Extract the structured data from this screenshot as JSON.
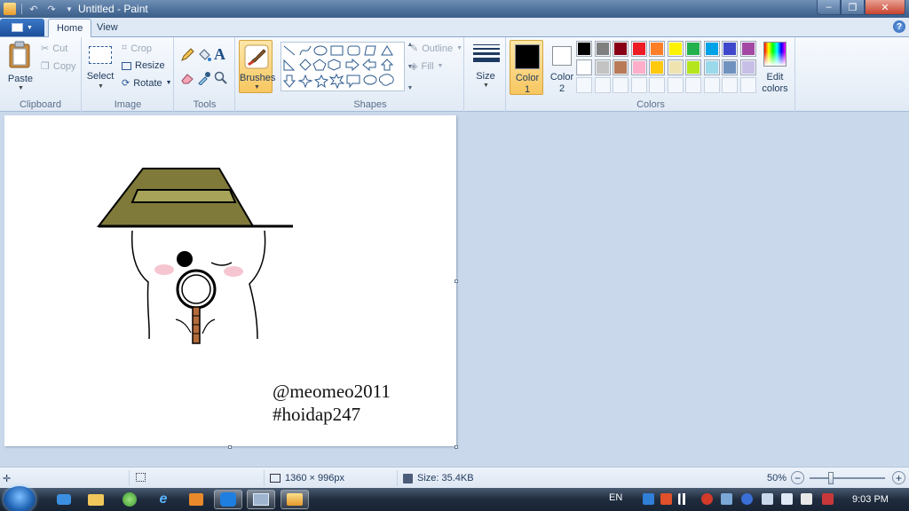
{
  "window": {
    "title": "Untitled - Paint",
    "controls": {
      "minimize": "–",
      "maximize": "❐",
      "close": "✕"
    }
  },
  "tabs": [
    {
      "label": "Home",
      "active": true
    },
    {
      "label": "View",
      "active": false
    }
  ],
  "ribbon": {
    "clipboard": {
      "group_label": "Clipboard",
      "paste": "Paste",
      "cut": "Cut",
      "copy": "Copy"
    },
    "image": {
      "group_label": "Image",
      "select": "Select",
      "crop": "Crop",
      "resize": "Resize",
      "rotate": "Rotate"
    },
    "tools": {
      "group_label": "Tools",
      "text_tool_glyph": "A"
    },
    "brushes": {
      "label": "Brushes"
    },
    "shapes": {
      "group_label": "Shapes",
      "outline": "Outline",
      "fill": "Fill"
    },
    "size": {
      "label": "Size"
    },
    "colors": {
      "group_label": "Colors",
      "color1": "Color 1",
      "color1_line1": "Color",
      "color1_line2": "1",
      "color2_line1": "Color",
      "color2_line2": "2",
      "edit_line1": "Edit",
      "edit_line2": "colors",
      "color1_value": "#000000",
      "color2_value": "#ffffff",
      "palette_row1": [
        "#000000",
        "#7f7f7f",
        "#880015",
        "#ed1c24",
        "#ff7f27",
        "#fff200",
        "#22b14c",
        "#00a2e8",
        "#3f48cc",
        "#a349a4"
      ],
      "palette_row2": [
        "#ffffff",
        "#c3c3c3",
        "#b97a57",
        "#ffaec9",
        "#ffc90e",
        "#efe4b0",
        "#b5e61d",
        "#99d9ea",
        "#7092be",
        "#c8bfe7"
      ]
    }
  },
  "canvas": {
    "watermark_line1": "@meomeo2011",
    "watermark_line2": "#hoidap247",
    "hat_color": "#7f7a3a",
    "handle_color": "#b36b3c"
  },
  "statusbar": {
    "dimensions": "1360 × 996px",
    "size": "Size: 35.4KB",
    "zoom": "50%",
    "zoom_out": "−",
    "zoom_in": "+"
  },
  "taskbar": {
    "language": "EN",
    "clock": "9:03 PM"
  }
}
